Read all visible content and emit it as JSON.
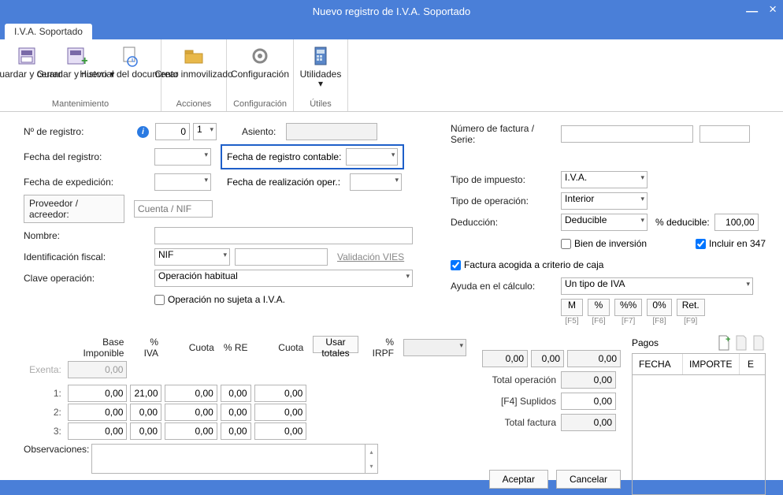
{
  "window": {
    "title": "Nuevo registro de I.V.A. Soportado"
  },
  "tab": {
    "label": "I.V.A. Soportado"
  },
  "ribbon": {
    "mantenimiento": {
      "group": "Mantenimiento",
      "guardar_cerrar": "Guardar y cerrar",
      "guardar_nuevo": "Guardar y nuevo ▾",
      "historial": "Historial del documento"
    },
    "acciones": {
      "group": "Acciones",
      "crear_inmov": "Crear inmovilizado"
    },
    "config": {
      "group": "Configuración",
      "config": "Configuración"
    },
    "utiles": {
      "group": "Útiles",
      "utilidades": "Utilidades\n▾"
    }
  },
  "left": {
    "n_registro": "Nº de registro:",
    "n_registro_val": "0",
    "n_registro_sec": "1",
    "asiento": "Asiento:",
    "fecha_registro": "Fecha del registro:",
    "fecha_reg_contable": "Fecha de registro contable:",
    "fecha_exped": "Fecha de expedición:",
    "fecha_real_oper": "Fecha de realización oper.:",
    "proveedor": "Proveedor / acreedor:",
    "proveedor_ph": "Cuenta / NIF",
    "nombre": "Nombre:",
    "id_fiscal": "Identificación fiscal:",
    "id_fiscal_val": "NIF",
    "validacion_vies": "Validación VIES",
    "clave_op": "Clave operación:",
    "clave_op_val": "Operación habitual",
    "op_no_sujeta": "Operación no sujeta a I.V.A."
  },
  "right": {
    "num_factura": "Número de factura / Serie:",
    "tipo_impuesto": "Tipo de impuesto:",
    "tipo_impuesto_val": "I.V.A.",
    "tipo_operacion": "Tipo de operación:",
    "tipo_operacion_val": "Interior",
    "deduccion": "Deducción:",
    "deduccion_val": "Deducible",
    "pct_deducible": "% deducible:",
    "pct_deducible_val": "100,00",
    "bien_inversion": "Bien de inversión",
    "incluir_347": "Incluir en 347",
    "factura_caja": "Factura acogida a criterio de caja",
    "ayuda_calculo": "Ayuda en el cálculo:",
    "ayuda_calculo_val": "Un tipo de IVA",
    "btn_m": "M",
    "btn_pct": "%",
    "btn_pctpct": "%%",
    "btn_0pct": "0%",
    "btn_ret": "Ret.",
    "f5": "[F5]",
    "f6": "[F6]",
    "f7": "[F7]",
    "f8": "[F8]",
    "f9": "[F9]"
  },
  "grid": {
    "base_imponible": "Base Imponible",
    "pct_iva": "% IVA",
    "cuota": "Cuota",
    "pct_re": "% RE",
    "cuota2": "Cuota",
    "usar_totales": "Usar totales",
    "pct_irpf": "% IRPF",
    "exenta": "Exenta:",
    "r1": "1:",
    "r2": "2:",
    "r3": "3:",
    "zero": "0,00",
    "iva1": "21,00"
  },
  "totals": {
    "irpf_zero": "0,00",
    "total_operacion": "Total operación",
    "f4_suplidos": "[F4] Suplidos",
    "total_factura": "Total factura"
  },
  "pagos": {
    "title": "Pagos",
    "fecha": "FECHA",
    "importe": "IMPORTE",
    "e": "E"
  },
  "obs": {
    "label": "Observaciones:"
  },
  "footer": {
    "aceptar": "Aceptar",
    "cancelar": "Cancelar"
  }
}
